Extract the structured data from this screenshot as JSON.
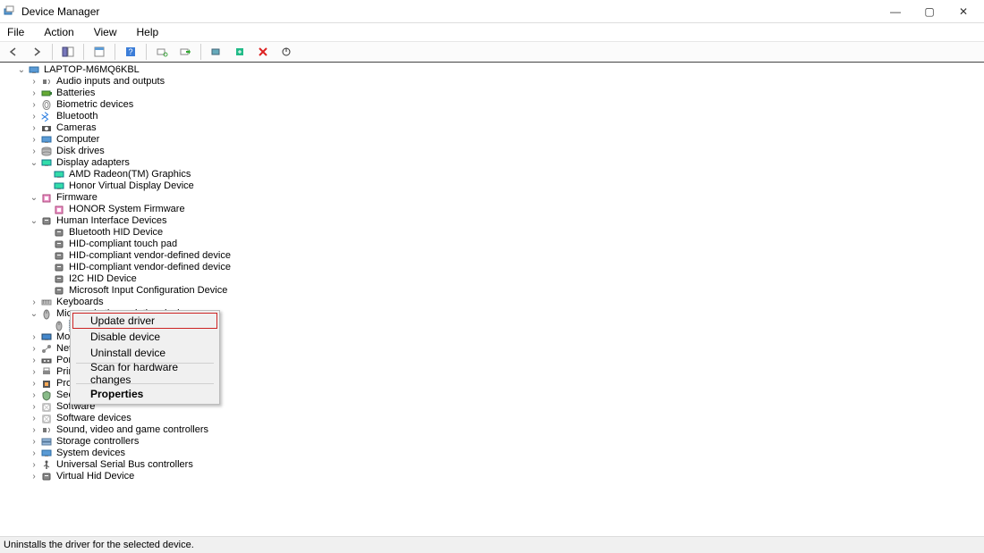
{
  "window": {
    "title": "Device Manager"
  },
  "menu": {
    "file": "File",
    "action": "Action",
    "view": "View",
    "help": "Help"
  },
  "root": {
    "name": "LAPTOP-M6MQ6KBL"
  },
  "categories": [
    {
      "label": "Audio inputs and outputs",
      "expanded": false,
      "icon": "audio"
    },
    {
      "label": "Batteries",
      "expanded": false,
      "icon": "battery"
    },
    {
      "label": "Biometric devices",
      "expanded": false,
      "icon": "biometric"
    },
    {
      "label": "Bluetooth",
      "expanded": false,
      "icon": "bluetooth"
    },
    {
      "label": "Cameras",
      "expanded": false,
      "icon": "camera"
    },
    {
      "label": "Computer",
      "expanded": false,
      "icon": "computer"
    },
    {
      "label": "Disk drives",
      "expanded": false,
      "icon": "disk"
    },
    {
      "label": "Display adapters",
      "expanded": true,
      "icon": "display",
      "children": [
        {
          "label": "AMD Radeon(TM) Graphics",
          "icon": "display"
        },
        {
          "label": "Honor Virtual Display Device",
          "icon": "display"
        }
      ]
    },
    {
      "label": "Firmware",
      "expanded": true,
      "icon": "firmware",
      "children": [
        {
          "label": "HONOR System Firmware",
          "icon": "firmware"
        }
      ]
    },
    {
      "label": "Human Interface Devices",
      "expanded": true,
      "icon": "hid",
      "children": [
        {
          "label": "Bluetooth HID Device",
          "icon": "hid"
        },
        {
          "label": "HID-compliant touch pad",
          "icon": "hid"
        },
        {
          "label": "HID-compliant vendor-defined device",
          "icon": "hid"
        },
        {
          "label": "HID-compliant vendor-defined device",
          "icon": "hid"
        },
        {
          "label": "I2C HID Device",
          "icon": "hid"
        },
        {
          "label": "Microsoft Input Configuration Device",
          "icon": "hid"
        }
      ]
    },
    {
      "label": "Keyboards",
      "expanded": false,
      "icon": "keyboard"
    },
    {
      "label": "Mice and other pointing devices",
      "expanded": true,
      "icon": "mouse",
      "children": [
        {
          "label": "HID-",
          "icon": "mouse",
          "selected": true
        }
      ]
    },
    {
      "label": "Monitors",
      "expanded": false,
      "icon": "monitor",
      "truncated": "Monito"
    },
    {
      "label": "Network",
      "expanded": false,
      "icon": "network",
      "truncated": "Network"
    },
    {
      "label": "Ports (C",
      "expanded": false,
      "icon": "port",
      "truncated": "Ports (C"
    },
    {
      "label": "Print qu",
      "expanded": false,
      "icon": "printer",
      "truncated": "Print qu"
    },
    {
      "label": "Processo",
      "expanded": false,
      "icon": "processor",
      "truncated": "Processo"
    },
    {
      "label": "Security",
      "expanded": false,
      "icon": "security",
      "truncated": "Security"
    },
    {
      "label": "Software",
      "expanded": false,
      "icon": "software",
      "truncated": "Software"
    },
    {
      "label": "Software devices",
      "expanded": false,
      "icon": "software"
    },
    {
      "label": "Sound, video and game controllers",
      "expanded": false,
      "icon": "audio"
    },
    {
      "label": "Storage controllers",
      "expanded": false,
      "icon": "storage"
    },
    {
      "label": "System devices",
      "expanded": false,
      "icon": "computer"
    },
    {
      "label": "Universal Serial Bus controllers",
      "expanded": false,
      "icon": "usb"
    },
    {
      "label": "Virtual Hid Device",
      "expanded": false,
      "icon": "hid"
    }
  ],
  "context_menu": {
    "update_driver": "Update driver",
    "disable_device": "Disable device",
    "uninstall_device": "Uninstall device",
    "scan_hardware": "Scan for hardware changes",
    "properties": "Properties"
  },
  "status_text": "Uninstalls the driver for the selected device."
}
